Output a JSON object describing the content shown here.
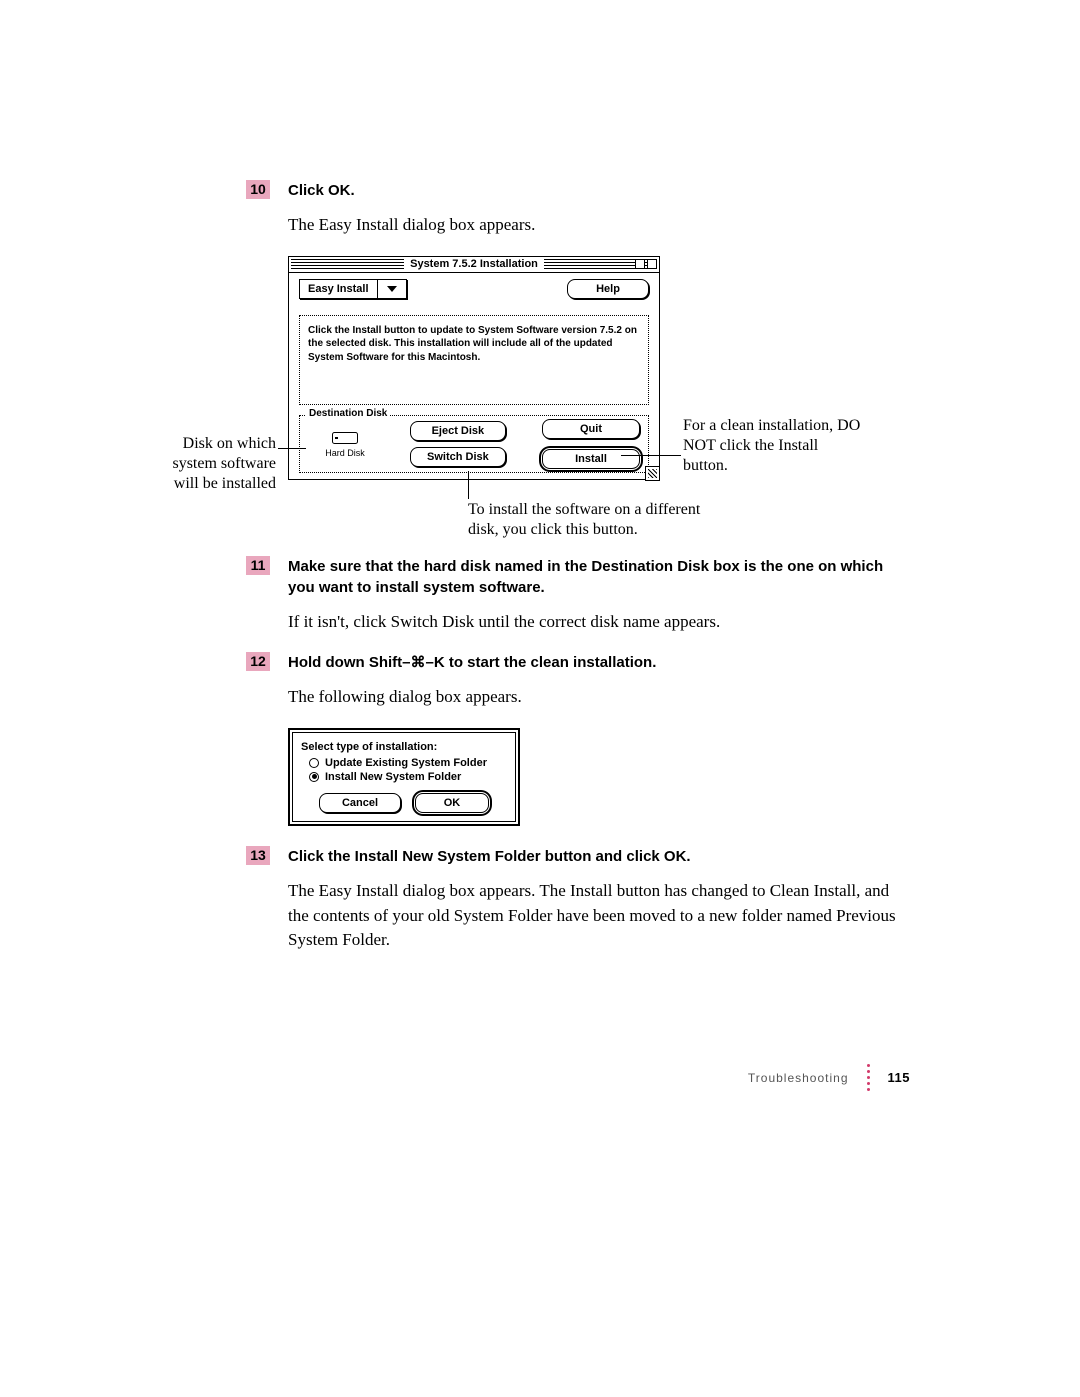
{
  "steps": {
    "s10": {
      "num": "10",
      "title": "Click OK.",
      "body": "The Easy Install dialog box appears."
    },
    "s11": {
      "num": "11",
      "title": "Make sure that the hard disk named in the Destination Disk box is the one on which you want to install system software.",
      "body": "If it isn't, click Switch Disk until the correct disk name appears."
    },
    "s12": {
      "num": "12",
      "title": "Hold down Shift–⌘–K to start the clean installation.",
      "body": "The following dialog box appears."
    },
    "s13": {
      "num": "13",
      "title": "Click the Install New System Folder button and click OK.",
      "body": "The Easy Install dialog box appears. The Install button has changed to Clean Install, and the contents of your old System Folder have been moved to a new folder named Previous System Folder."
    }
  },
  "dialog1": {
    "title": "System 7.5.2 Installation",
    "popup": "Easy Install",
    "help": "Help",
    "info": "Click the Install button to update to System Software version 7.5.2 on the selected disk.  This installation will include all of the updated System Software for this Macintosh.",
    "dest_legend": "Destination Disk",
    "disk_name": "Hard Disk",
    "eject": "Eject Disk",
    "switch": "Switch Disk",
    "quit": "Quit",
    "install": "Install"
  },
  "callouts": {
    "left": "Disk on which system software will be installed",
    "right": "For a clean installation, DO NOT click the Install button.",
    "bottom": "To install the software on a different disk, you click this button."
  },
  "dialog2": {
    "title": "Select type of installation:",
    "opt1": "Update Existing System Folder",
    "opt2": "Install New System Folder",
    "cancel": "Cancel",
    "ok": "OK"
  },
  "footer": {
    "section": "Troubleshooting",
    "page": "115"
  }
}
